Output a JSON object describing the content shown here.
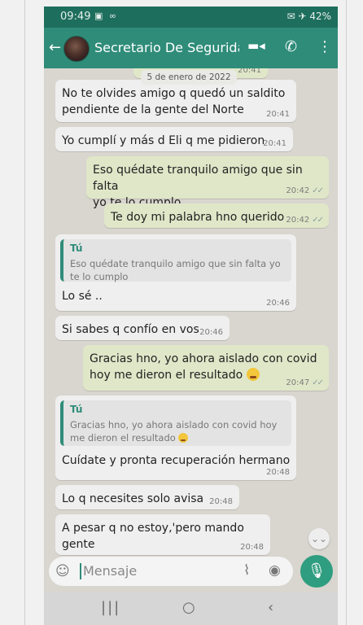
{
  "status_bar": {
    "time": "09:49",
    "left_icons": "▣ ∞",
    "right": "✉ ✈ 42%"
  },
  "app_bar": {
    "back_glyph": "←",
    "contact_name": "Secretario De Segurida...",
    "video_glyph": "▬◂",
    "call_glyph": "✆",
    "menu_glyph": "⋮"
  },
  "date_chip": "5 de enero de 2022",
  "messages": [
    {
      "dir": "in",
      "text": "No te olvides amigo q quedó un saldito pendiente de la gente del Norte",
      "line1": "No te olvides amigo q quedó un saldito",
      "line2": "pendiente de la gente del Norte",
      "time": "20:41"
    },
    {
      "dir": "in",
      "text": "Yo cumplí y más d Eli q me pidieron",
      "time": "20:41"
    },
    {
      "dir": "out",
      "line1": "Eso quédate tranquilo amigo que sin falta",
      "line2": "yo te lo cumplo",
      "time": "20:42",
      "status": "✓✓"
    },
    {
      "dir": "out",
      "text": "Te doy mi palabra hno querido",
      "time": "20:42",
      "status": "✓✓"
    },
    {
      "dir": "in",
      "quote_author": "Tú",
      "quote_line1": "Eso quédate tranquilo amigo que sin falta yo",
      "quote_line2": "te lo cumplo",
      "text": "Lo sé ..",
      "time": "20:46"
    },
    {
      "dir": "in",
      "text": "Si sabes q confío en vos",
      "time": "20:46"
    },
    {
      "dir": "out",
      "line1": "Gracias hno, yo ahora aislado con covid",
      "line2": "hoy me dieron el resultado",
      "time": "20:47",
      "status": "✓✓",
      "emoji": "weary-face"
    },
    {
      "dir": "in",
      "quote_author": "Tú",
      "quote_line1": "Gracias hno, yo ahora aislado con covid hoy",
      "quote_line2": "me dieron el resultado",
      "text": "Cuídate y pronta recuperación hermano",
      "time": "20:48"
    },
    {
      "dir": "in",
      "text": "Lo q necesites solo avisa",
      "time": "20:48"
    },
    {
      "dir": "in",
      "text": "A pesar q no estoy,'pero mando gente",
      "time": "20:48"
    }
  ],
  "partial_top": {
    "time_hint": "20:41"
  },
  "input": {
    "placeholder": "Mensaje",
    "emoji_glyph": "☺",
    "attach_glyph": "⌇",
    "camera_glyph": "◉"
  },
  "mic_glyph": "🎙",
  "scroll_glyph": "⌄⌄",
  "nav": {
    "recent": "|||",
    "home": "○",
    "back": "‹"
  },
  "colors": {
    "header": "#2f8c79",
    "statusbar": "#1e6e5d",
    "incoming": "#efefef",
    "outgoing": "#dfe7c8",
    "chat_bg": "#d9d5cf"
  }
}
